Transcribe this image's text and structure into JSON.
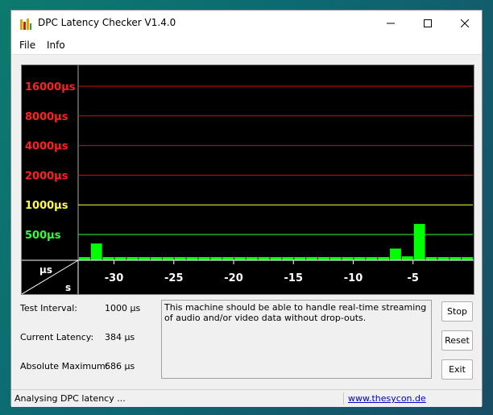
{
  "window": {
    "title": "DPC Latency Checker V1.4.0"
  },
  "menu": {
    "items": [
      "File",
      "Info"
    ]
  },
  "chart_data": {
    "type": "bar",
    "y_ticks": [
      {
        "label": "16000µs",
        "value": 16000,
        "color": "#ff2020"
      },
      {
        "label": "8000µs",
        "value": 8000,
        "color": "#ff2020"
      },
      {
        "label": "4000µs",
        "value": 4000,
        "color": "#ff2020"
      },
      {
        "label": "2000µs",
        "value": 2000,
        "color": "#ff2020"
      },
      {
        "label": "1000µs",
        "value": 1000,
        "color": "#ffff40"
      },
      {
        "label": "500µs",
        "value": 500,
        "color": "#30ff30"
      }
    ],
    "y_unit": "µs",
    "x_unit": "s",
    "x_ticks": [
      "-30",
      "-25",
      "-20",
      "-15",
      "-10",
      "-5"
    ],
    "values": [
      95,
      405,
      105,
      80,
      120,
      90,
      120,
      90,
      230,
      90,
      120,
      100,
      100,
      110,
      110,
      80,
      100,
      80,
      110,
      110,
      110,
      110,
      160,
      110,
      100,
      90,
      360,
      300,
      640,
      90,
      100,
      120,
      150
    ],
    "bar_color": "#00ff00"
  },
  "stats": {
    "test_interval_label": "Test Interval:",
    "test_interval_value": "1000 µs",
    "current_latency_label": "Current Latency:",
    "current_latency_value": "384 µs",
    "absolute_maximum_label": "Absolute Maximum:",
    "absolute_maximum_value": "686 µs"
  },
  "message": "This machine should be able to handle real-time streaming of audio and/or video data without drop-outs.",
  "buttons": {
    "stop": "Stop",
    "reset": "Reset",
    "exit": "Exit"
  },
  "status": {
    "text": "Analysing DPC latency ...",
    "link": "www.thesycon.de"
  }
}
